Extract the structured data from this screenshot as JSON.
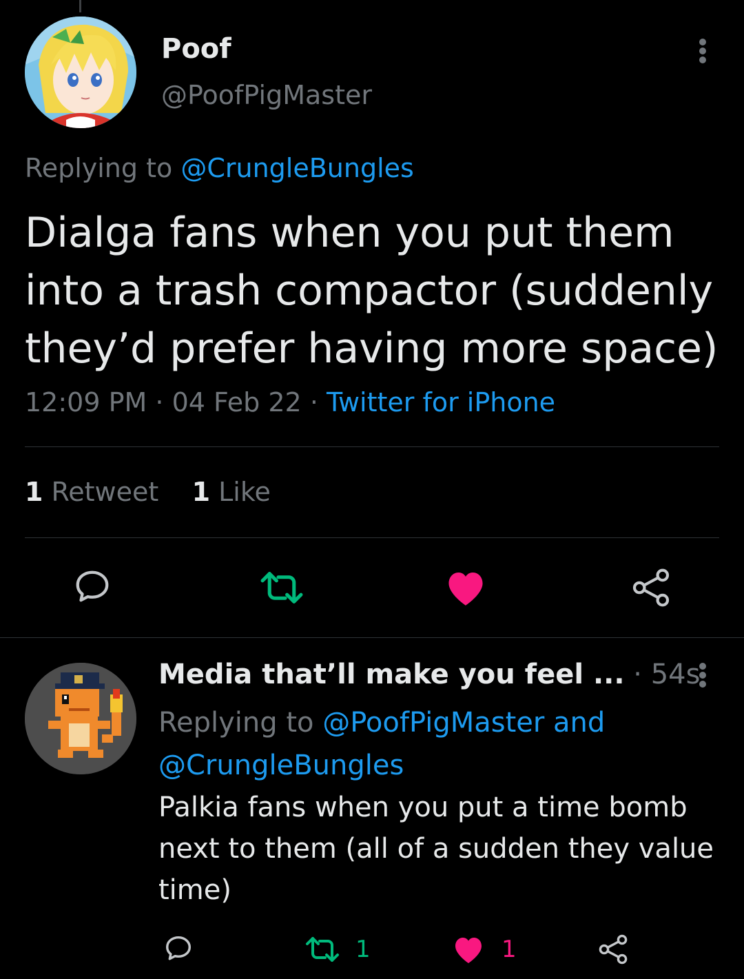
{
  "main_tweet": {
    "display_name": "Poof",
    "handle": "@PoofPigMaster",
    "replying_prefix": "Replying to",
    "replying_to": "@CrungleBungles",
    "text": "Dialga fans when you put them into a trash compactor (suddenly they’d prefer having more space)",
    "time": "12:09 PM",
    "date": "04 Feb 22",
    "source": "Twitter for iPhone",
    "separator": "·",
    "retweet_count": "1",
    "retweet_label": "Retweet",
    "like_count": "1",
    "like_label": "Like"
  },
  "reply_tweet": {
    "display_name": "Media that’ll make you feel ...",
    "age": "54s",
    "separator": "·",
    "replying_prefix": "Replying to",
    "replying_to_1": "@PoofPigMaster",
    "conjunction": "and",
    "replying_to_2": "@CrungleBungles",
    "text": "Palkia fans when you put a time bomb next to them (all of a sudden they value time)",
    "retweet_count": "1",
    "like_count": "1"
  },
  "icons": {
    "reply": "reply-icon",
    "retweet": "retweet-icon",
    "like": "heart-icon",
    "share": "share-icon",
    "more": "more-vertical-icon"
  },
  "colors": {
    "background": "#000000",
    "text_primary": "#e7e9ea",
    "text_secondary": "#71767b",
    "link": "#1d9bf0",
    "retweet_green": "#00ba7c",
    "like_pink": "#f91880",
    "divider": "#2f3336"
  }
}
